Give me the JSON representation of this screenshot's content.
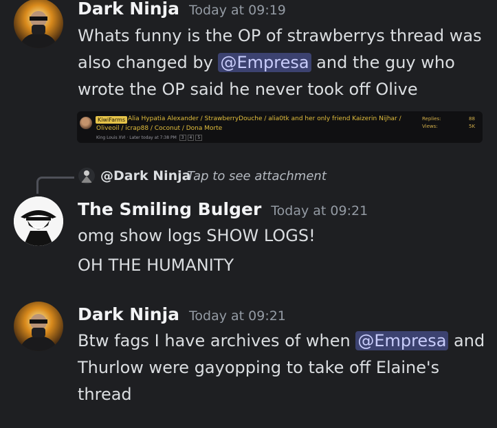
{
  "messages": [
    {
      "username": "Dark Ninja",
      "timestamp": "Today at 09:19",
      "lines": [
        "Whats funny is the OP of strawberrys thread was",
        {
          "before": "also changed by ",
          "mention": "@Empresa",
          "after": " and the guy who"
        },
        "wrote the OP said he never took off Olive"
      ],
      "embed": {
        "badge": "KiwiFarms",
        "title_line1": "Alia Hypatia Alexander / StrawberryDouche / alia0tk and her only friend Kaizerin Nijhar /",
        "title_line2": "Oliveoil / icrap88 / Coconut / Dona Morte",
        "meta": "King Louis XVI · Later today at 7:38 PM",
        "pages": [
          "3",
          "4",
          "5"
        ],
        "replies_label": "Replies:",
        "replies_value": "88",
        "views_label": "Views:",
        "views_value": "5K"
      }
    },
    {
      "reply": {
        "name": "@Dark Ninja",
        "text": "Tap to see attachment"
      },
      "username": "The Smiling Bulger",
      "timestamp": "Today at 09:21",
      "lines": [
        "omg show logs SHOW LOGS!",
        "OH THE HUMANITY"
      ]
    },
    {
      "username": "Dark Ninja",
      "timestamp": "Today at 09:21",
      "lines": [
        {
          "before": "Btw fags I have archives of when ",
          "mention": "@Empresa",
          "after": " and"
        },
        "Thurlow were gayopping to take off Elaine's",
        "thread"
      ]
    }
  ],
  "colors": {
    "background": "#1e1f22",
    "mention_bg": "#3c4270",
    "mention_text": "#c9cdfb",
    "timestamp": "#949ba4"
  }
}
